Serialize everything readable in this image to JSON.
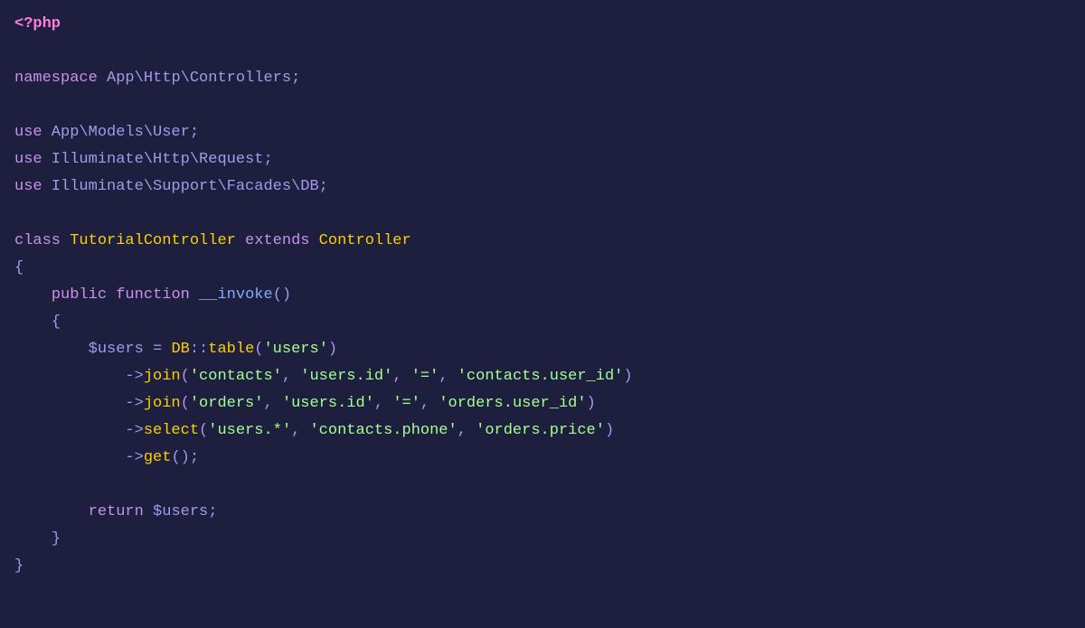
{
  "code": {
    "line1": {
      "phpTag": "<?php"
    },
    "line3": {
      "keyword": "namespace",
      "path": " App\\Http\\Controllers;"
    },
    "line5": {
      "keyword": "use",
      "path": " App\\Models\\User;"
    },
    "line6": {
      "keyword": "use",
      "path": " Illuminate\\Http\\Request;"
    },
    "line7": {
      "keyword": "use",
      "path": " Illuminate\\Support\\Facades\\DB;"
    },
    "line9": {
      "classKw": "class",
      "className": " TutorialController",
      "extendsKw": " extends",
      "parentClass": " Controller"
    },
    "line10": {
      "brace": "{"
    },
    "line11": {
      "indent": "    ",
      "public": "public",
      "function": " function",
      "funcName": " __invoke",
      "parens": "()"
    },
    "line12": {
      "indent": "    ",
      "brace": "{"
    },
    "line13": {
      "indent": "        ",
      "variable": "$users",
      "equals": " = ",
      "dbClass": "DB",
      "dblColon": "::",
      "tableFn": "table",
      "openParen": "(",
      "str1": "'users'",
      "closeParen": ")"
    },
    "line14": {
      "indent": "            ",
      "arrow": "->",
      "joinFn": "join",
      "openParen": "(",
      "str1": "'contacts'",
      "comma1": ", ",
      "str2": "'users.id'",
      "comma2": ", ",
      "str3": "'='",
      "comma3": ", ",
      "str4": "'contacts.user_id'",
      "closeParen": ")"
    },
    "line15": {
      "indent": "            ",
      "arrow": "->",
      "joinFn": "join",
      "openParen": "(",
      "str1": "'orders'",
      "comma1": ", ",
      "str2": "'users.id'",
      "comma2": ", ",
      "str3": "'='",
      "comma3": ", ",
      "str4": "'orders.user_id'",
      "closeParen": ")"
    },
    "line16": {
      "indent": "            ",
      "arrow": "->",
      "selectFn": "select",
      "openParen": "(",
      "str1": "'users.*'",
      "comma1": ", ",
      "str2": "'contacts.phone'",
      "comma2": ", ",
      "str3": "'orders.price'",
      "closeParen": ")"
    },
    "line17": {
      "indent": "            ",
      "arrow": "->",
      "getFn": "get",
      "parens": "();"
    },
    "line19": {
      "indent": "        ",
      "returnKw": "return",
      "variable": " $users",
      "semi": ";"
    },
    "line20": {
      "indent": "    ",
      "brace": "}"
    },
    "line21": {
      "brace": "}"
    }
  }
}
